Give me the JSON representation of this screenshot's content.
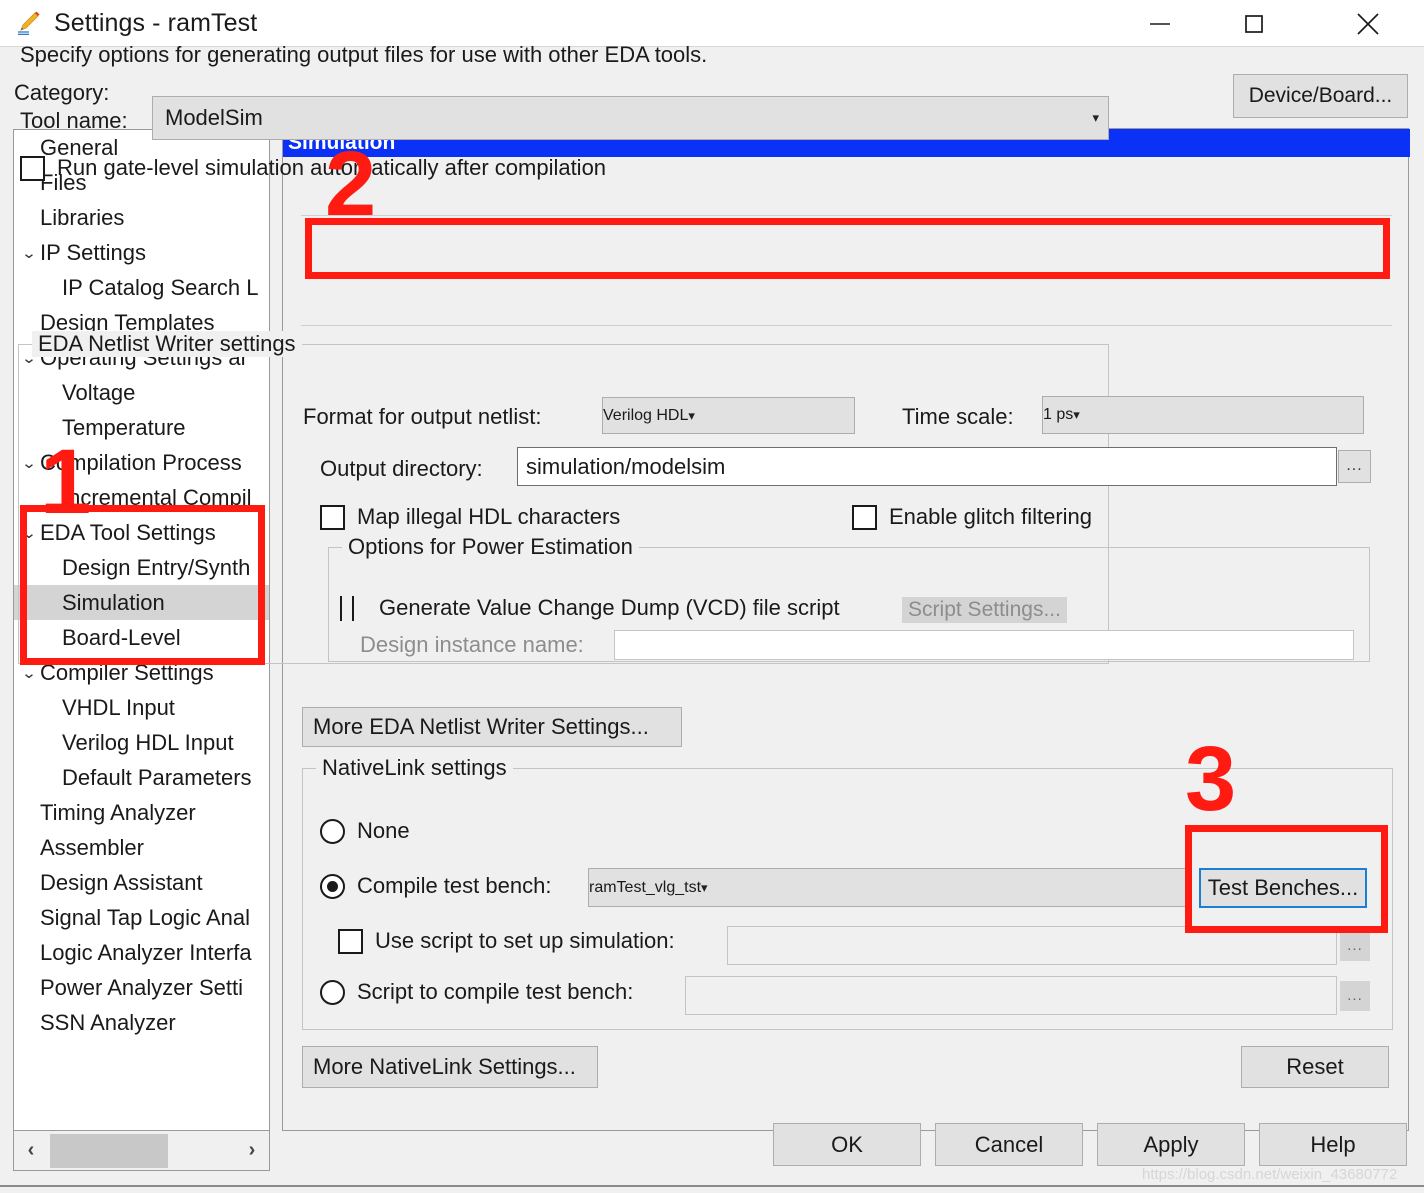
{
  "window": {
    "title": "Settings - ramTest",
    "icon": "pencil-icon",
    "controls": {
      "minimize": "—",
      "maximize": "☐",
      "close": "✕"
    }
  },
  "category_label": "Category:",
  "device_board_button": "Device/Board...",
  "sidebar": {
    "items": [
      {
        "label": "General",
        "arrow": "",
        "indent": 0,
        "selected": false
      },
      {
        "label": "Files",
        "arrow": "",
        "indent": 0,
        "selected": false
      },
      {
        "label": "Libraries",
        "arrow": "",
        "indent": 0,
        "selected": false
      },
      {
        "label": "IP Settings",
        "arrow": "⌄",
        "indent": 0,
        "selected": false
      },
      {
        "label": "IP Catalog Search L",
        "arrow": "",
        "indent": 1,
        "selected": false
      },
      {
        "label": "Design Templates",
        "arrow": "",
        "indent": 0,
        "selected": false
      },
      {
        "label": "Operating Settings ar",
        "arrow": "⌄",
        "indent": 0,
        "selected": false
      },
      {
        "label": "Voltage",
        "arrow": "",
        "indent": 1,
        "selected": false
      },
      {
        "label": "Temperature",
        "arrow": "",
        "indent": 1,
        "selected": false
      },
      {
        "label": "Compilation Process",
        "arrow": "⌄",
        "indent": 0,
        "selected": false
      },
      {
        "label": "Incremental Compil",
        "arrow": "",
        "indent": 1,
        "selected": false
      },
      {
        "label": "EDA Tool Settings",
        "arrow": "⌄",
        "indent": 0,
        "selected": false
      },
      {
        "label": "Design Entry/Synth",
        "arrow": "",
        "indent": 1,
        "selected": false
      },
      {
        "label": "Simulation",
        "arrow": "",
        "indent": 1,
        "selected": true
      },
      {
        "label": "Board-Level",
        "arrow": "",
        "indent": 1,
        "selected": false
      },
      {
        "label": "Compiler Settings",
        "arrow": "⌄",
        "indent": 0,
        "selected": false
      },
      {
        "label": "VHDL Input",
        "arrow": "",
        "indent": 1,
        "selected": false
      },
      {
        "label": "Verilog HDL Input",
        "arrow": "",
        "indent": 1,
        "selected": false
      },
      {
        "label": "Default Parameters",
        "arrow": "",
        "indent": 1,
        "selected": false
      },
      {
        "label": "Timing Analyzer",
        "arrow": "",
        "indent": 0,
        "selected": false
      },
      {
        "label": "Assembler",
        "arrow": "",
        "indent": 0,
        "selected": false
      },
      {
        "label": "Design Assistant",
        "arrow": "",
        "indent": 0,
        "selected": false
      },
      {
        "label": "Signal Tap Logic Anal",
        "arrow": "",
        "indent": 0,
        "selected": false
      },
      {
        "label": "Logic Analyzer Interfa",
        "arrow": "",
        "indent": 0,
        "selected": false
      },
      {
        "label": "Power Analyzer Setti",
        "arrow": "",
        "indent": 0,
        "selected": false
      },
      {
        "label": "SSN Analyzer",
        "arrow": "",
        "indent": 0,
        "selected": false
      }
    ],
    "scroll_left_arrow": "‹",
    "scroll_right_arrow": "›"
  },
  "panel": {
    "header": "Simulation",
    "description": "Specify options for generating output files for use with other EDA tools.",
    "tool_name_label": "Tool name:",
    "tool_name_value": "ModelSim",
    "run_gate_level_label": "Run gate-level simulation automatically after compilation",
    "run_gate_level_checked": false
  },
  "eda_netlist_writer": {
    "group_title": "EDA Netlist Writer settings",
    "format_label": "Format for output netlist:",
    "format_value": "Verilog HDL",
    "time_scale_label": "Time scale:",
    "time_scale_value": "1 ps",
    "output_dir_label": "Output directory:",
    "output_dir_value": "simulation/modelsim",
    "browse_button": "...",
    "map_illegal_label": "Map illegal HDL characters",
    "map_illegal_checked": false,
    "glitch_filter_label": "Enable glitch filtering",
    "glitch_filter_checked": false,
    "power_group_title": "Options for Power Estimation",
    "vcd_label": "Generate Value Change Dump (VCD) file script",
    "vcd_checked": false,
    "script_settings_button": "Script Settings...",
    "design_instance_label": "Design instance name:",
    "design_instance_value": ""
  },
  "more_eda_button": "More EDA Netlist Writer Settings...",
  "nativelink": {
    "group_title": "NativeLink settings",
    "none_label": "None",
    "none_selected": false,
    "compile_tb_label": "Compile test bench:",
    "compile_tb_selected": true,
    "compile_tb_value": "ramTest_vlg_tst",
    "test_benches_button": "Test Benches...",
    "use_script_label": "Use script to set up simulation:",
    "use_script_checked": false,
    "use_script_value": "",
    "use_script_browse": "...",
    "script_compile_label": "Script to compile test bench:",
    "script_compile_selected": false,
    "script_compile_value": "",
    "script_compile_browse": "...",
    "more_nativelink_button": "More NativeLink Settings...",
    "reset_button": "Reset"
  },
  "dialog_buttons": {
    "ok": "OK",
    "cancel": "Cancel",
    "apply": "Apply",
    "help": "Help"
  },
  "annotations": {
    "one": "1",
    "two": "2",
    "three": "3",
    "color": "#ff1a12"
  },
  "watermark": "https://blog.csdn.net/weixin_43680772",
  "colors": {
    "panel_header_blue": "#0a31f5",
    "focus_blue": "#1b7fd4",
    "selection_gray": "#d4d4d4",
    "window_bg": "#f0f0f0"
  }
}
